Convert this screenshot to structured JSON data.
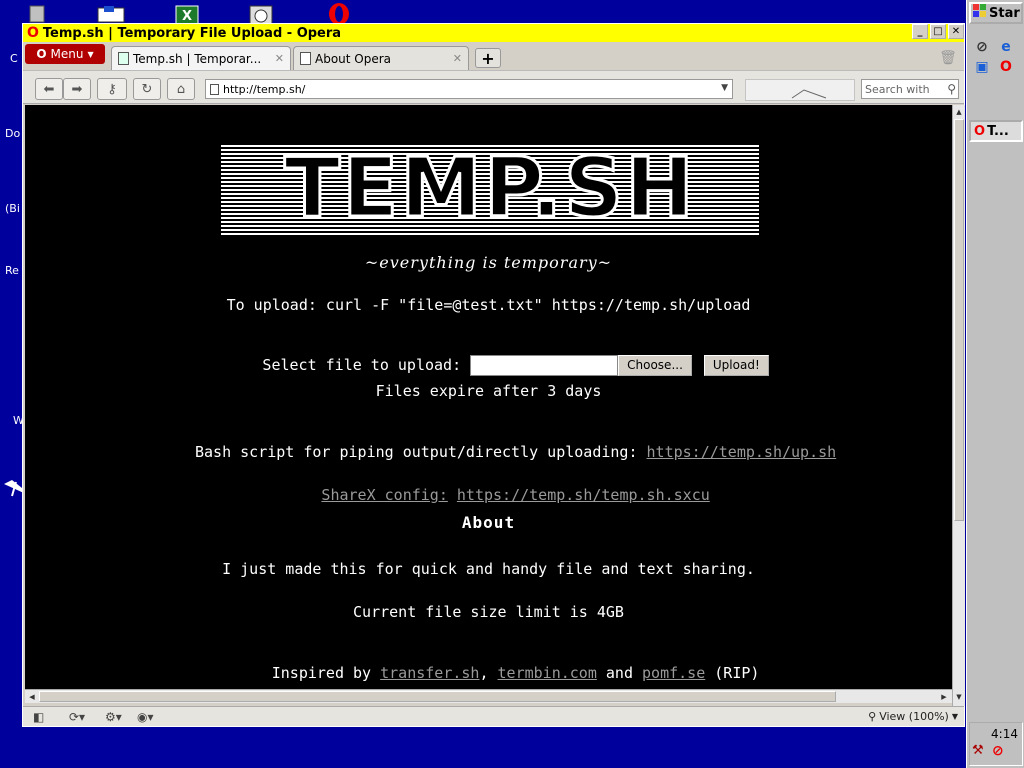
{
  "desktop": {
    "labels": [
      "C",
      "Do",
      "(Bi",
      "Re",
      "W"
    ]
  },
  "taskbar": {
    "start_label": "Star",
    "task_label": "T...",
    "clock": "4:14"
  },
  "window": {
    "title": "Temp.sh | Temporary File Upload - Opera",
    "menu_label": "Menu",
    "tabs": [
      {
        "label": "Temp.sh | Temporar..."
      },
      {
        "label": "About Opera"
      }
    ],
    "address": "http://temp.sh/",
    "search_placeholder": "Search with",
    "zoom": "View (100%)"
  },
  "page": {
    "logo": "TEMP.SH",
    "tagline": "~everything is temporary~",
    "upload_cmd": "To upload: curl -F \"file=@test.txt\" https://temp.sh/upload",
    "select_label": "Select file to upload: ",
    "choose_btn": "Choose...",
    "upload_btn": "Upload!",
    "expire": "Files expire after 3 days",
    "bash_label": "Bash script for piping output/directly uploading: ",
    "bash_link": "https://temp.sh/up.sh",
    "sharex_label": "ShareX config:",
    "sharex_link": "https://temp.sh/temp.sh.sxcu",
    "about_heading": "About",
    "about_text": "I just made this for quick and handy file and text sharing.",
    "size_limit": "Current file size limit is 4GB",
    "inspired_prefix": "Inspired by ",
    "link_transfer": "transfer.sh",
    "sep_comma": ", ",
    "link_termbin": "termbin.com",
    "sep_and": " and ",
    "link_pomf": "pomf.se",
    "suffix_rip": " (RIP)"
  }
}
